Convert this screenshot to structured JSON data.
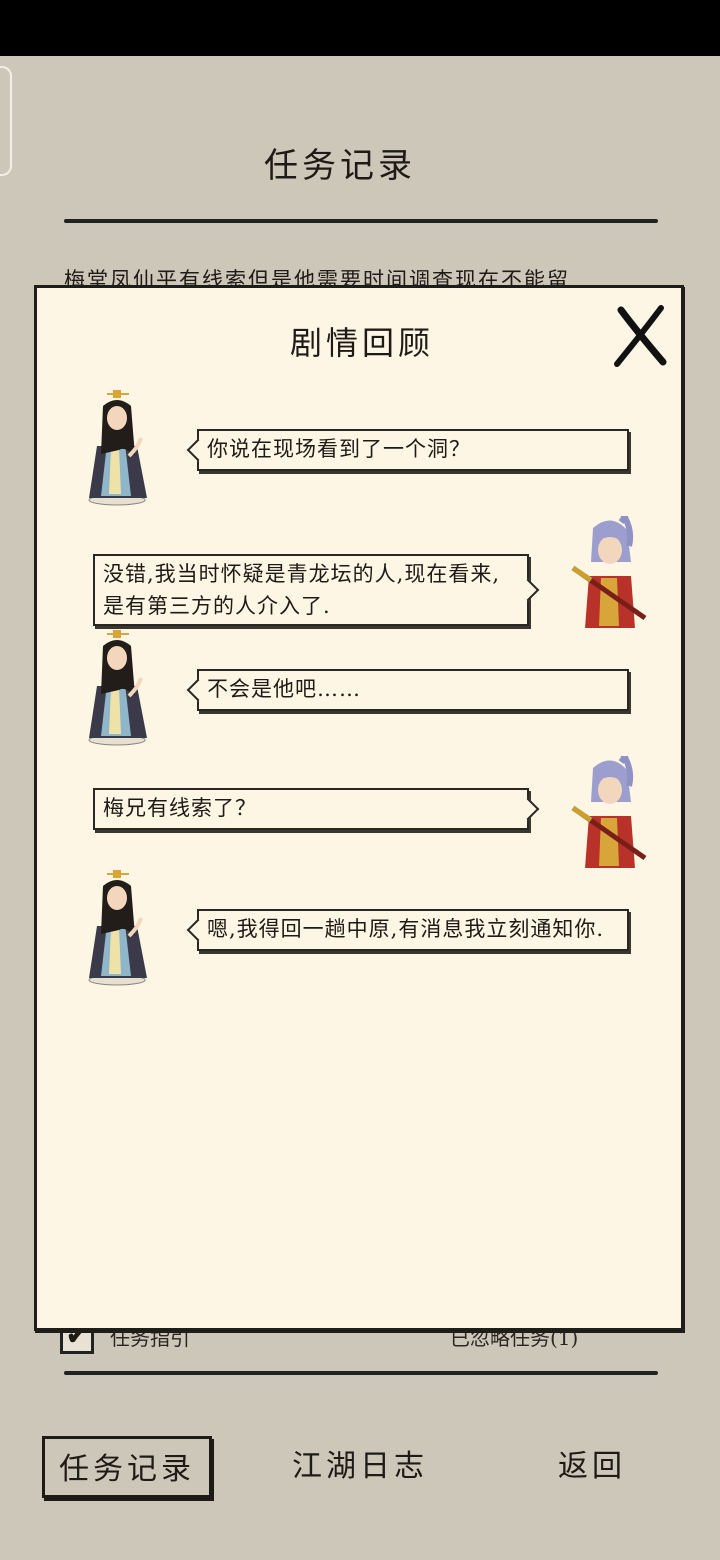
{
  "page": {
    "title": "任务记录",
    "background_task_text": "梅堂凤仙平有线索但是他需要时间调查现在不能留",
    "guide_checkbox_mark": "✔",
    "guide_label": "任务指引",
    "ignored_label": "已忽略任务(1)"
  },
  "modal": {
    "title": "剧情回顾",
    "close_icon": "close-x-icon",
    "messages": [
      {
        "speaker": "female-scholar",
        "side": "left",
        "text": "你说在现场看到了一个洞？"
      },
      {
        "speaker": "swordsman",
        "side": "right",
        "text": "没错,我当时怀疑是青龙坛的人,现在看来,是有第三方的人介入了."
      },
      {
        "speaker": "female-scholar",
        "side": "left",
        "text": "不会是他吧……"
      },
      {
        "speaker": "swordsman",
        "side": "right",
        "text": "梅兄有线索了？"
      },
      {
        "speaker": "female-scholar",
        "side": "left",
        "text": "嗯,我得回一趟中原,有消息我立刻通知你."
      }
    ]
  },
  "nav": {
    "tabs": [
      {
        "label": "任务记录",
        "active": true
      },
      {
        "label": "江湖日志",
        "active": false
      },
      {
        "label": "返回",
        "active": false
      }
    ]
  },
  "colors": {
    "background": "#cdc7b9",
    "modal_paper": "#fdf6e4",
    "ink": "#1e1b17"
  }
}
